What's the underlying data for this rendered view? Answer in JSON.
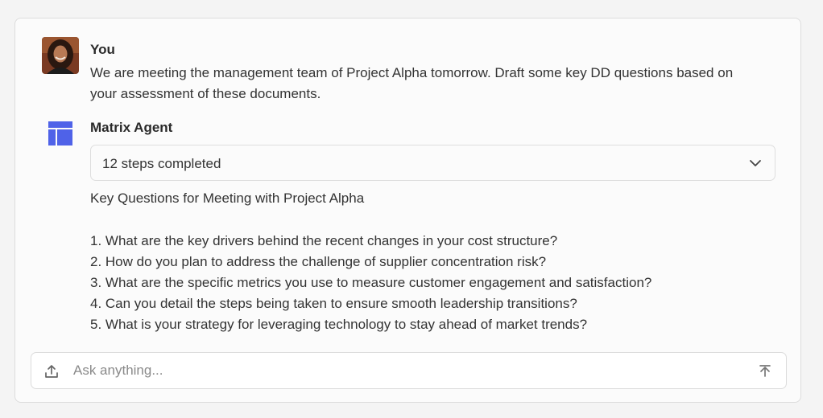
{
  "user": {
    "name": "You",
    "message": "We are meeting the management team of Project Alpha tomorrow. Draft some key DD questions based on your assessment of these documents.",
    "avatar_icon": "user-avatar"
  },
  "agent": {
    "name": "Matrix Agent",
    "icon": "table-layout-icon",
    "icon_color": "#4f62e8",
    "steps_label": "12 steps completed",
    "answer_title": "Key Questions for Meeting with Project Alpha",
    "questions": [
      "1. What are the key drivers behind the recent changes in your cost structure?",
      "2. How do you plan to address the challenge of supplier concentration risk?",
      "3. What are the specific metrics you use to measure customer engagement and satisfaction?",
      "4. Can you detail the steps being taken to ensure smooth leadership transitions?",
      "5. What is your strategy for leveraging technology to stay ahead of market trends?"
    ]
  },
  "composer": {
    "placeholder": "Ask anything...",
    "value": "",
    "upload_icon": "upload-icon",
    "send_icon": "send-arrow-icon"
  }
}
